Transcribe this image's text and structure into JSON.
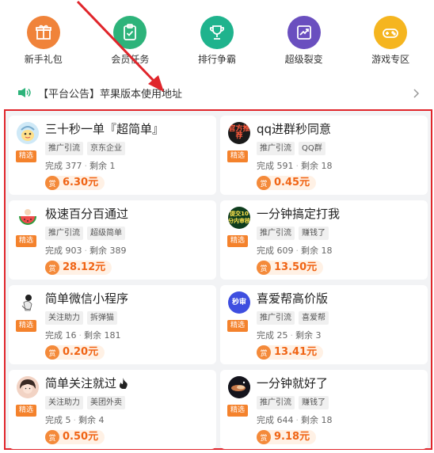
{
  "nav": {
    "items": [
      {
        "label": "新手礼包",
        "icon": "gift-icon",
        "color": "#f0833a"
      },
      {
        "label": "会员任务",
        "icon": "clipboard-check-icon",
        "color": "#2db37a"
      },
      {
        "label": "排行争霸",
        "icon": "trophy-icon",
        "color": "#1fb38d"
      },
      {
        "label": "超级裂变",
        "icon": "growth-chart-icon",
        "color": "#6a4fbf"
      },
      {
        "label": "游戏专区",
        "icon": "gamepad-icon",
        "color": "#f5b51f"
      }
    ]
  },
  "notice": {
    "text": "【平台公告】苹果版本使用地址",
    "icon": "speaker-icon",
    "arrow_icon": "chevron-right-icon"
  },
  "annotation": {
    "color": "#e0252b"
  },
  "tasks": [
    {
      "title": "三十秒一单『超简单』",
      "tags": [
        "推广引流",
        "京东企业"
      ],
      "badge": "精选",
      "done_label": "完成",
      "done": "377",
      "left_label": "剩余",
      "left": "1",
      "reward_label": "赏",
      "reward": "6.30元",
      "avatar": {
        "style": "cartoon",
        "text": ""
      }
    },
    {
      "title": "qq进群秒同意",
      "tags": [
        "推广引流",
        "QQ群"
      ],
      "badge": "精选",
      "done_label": "完成",
      "done": "591",
      "left_label": "剩余",
      "left": "18",
      "reward_label": "赏",
      "reward": "0.45元",
      "avatar": {
        "style": "dark",
        "text": "官方推荐"
      }
    },
    {
      "title": "极速百分百通过",
      "tags": [
        "推广引流",
        "超级简单"
      ],
      "badge": "精选",
      "done_label": "完成",
      "done": "903",
      "left_label": "剩余",
      "left": "389",
      "reward_label": "赏",
      "reward": "28.12元",
      "avatar": {
        "style": "watermelon",
        "text": ""
      }
    },
    {
      "title": "一分钟搞定打我",
      "tags": [
        "推广引流",
        "赚钱了"
      ],
      "badge": "精选",
      "done_label": "完成",
      "done": "609",
      "left_label": "剩余",
      "left": "18",
      "reward_label": "赏",
      "reward": "13.50元",
      "avatar": {
        "style": "green-dark",
        "text": "提交10分内审核"
      }
    },
    {
      "title": "简单微信小程序",
      "tags": [
        "关注助力",
        "拆弹猫"
      ],
      "badge": "精选",
      "done_label": "完成",
      "done": "16",
      "left_label": "剩余",
      "left": "181",
      "reward_label": "赏",
      "reward": "0.20元",
      "avatar": {
        "style": "figure",
        "text": ""
      }
    },
    {
      "title": "喜爱帮高价版",
      "tags": [
        "推广引流",
        "喜爱帮"
      ],
      "badge": "精选",
      "done_label": "完成",
      "done": "25",
      "left_label": "剩余",
      "left": "3",
      "reward_label": "赏",
      "reward": "13.41元",
      "avatar": {
        "style": "blue",
        "text": "秒审"
      }
    },
    {
      "title": "简单关注就过",
      "tags": [
        "关注助力",
        "美团外卖"
      ],
      "badge": "精选",
      "done_label": "完成",
      "done": "5",
      "left_label": "剩余",
      "left": "4",
      "reward_label": "赏",
      "reward": "0.50元",
      "avatar": {
        "style": "photo",
        "text": ""
      },
      "title_icon": "fire-icon"
    },
    {
      "title": "一分钟就好了",
      "tags": [
        "推广引流",
        "赚钱了"
      ],
      "badge": "精选",
      "done_label": "完成",
      "done": "644",
      "left_label": "剩余",
      "left": "18",
      "reward_label": "赏",
      "reward": "9.18元",
      "avatar": {
        "style": "night",
        "text": ""
      }
    }
  ],
  "colors": {
    "accent": "#f06414",
    "badge": "#f4822c",
    "frame": "#e0252b"
  }
}
